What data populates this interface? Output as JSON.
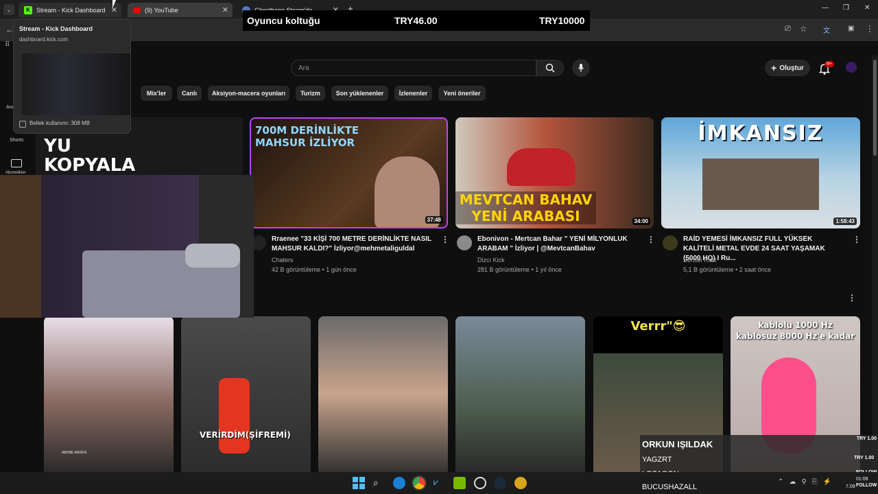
{
  "browser": {
    "tabs": [
      {
        "title": "Stream - Kick Dashboard",
        "icon": "kick-icon",
        "color": "#53fc18"
      },
      {
        "title": "(9) YouTube",
        "icon": "youtube-icon",
        "color": "#ff0000"
      },
      {
        "title": "Ghostbane Steam'de",
        "icon": "steam-icon",
        "color": "#4f7bc4"
      }
    ],
    "new_tab_label": "+"
  },
  "tab_preview": {
    "title": "Stream - Kick Dashboard",
    "url": "dashboard.kick.com",
    "memory": "Bellek kullanımı: 308 MB"
  },
  "price_overlay": {
    "item": "Oyuncu koltuğu",
    "current": "TRY46.00",
    "goal": "TRY10000"
  },
  "youtube": {
    "search_placeholder": "Ara",
    "create_label": "Oluştur",
    "notifications": "9+",
    "sidebar": [
      {
        "label": "Ana",
        "icon": "home-icon"
      },
      {
        "label": "Shorts",
        "icon": "shorts-icon"
      },
      {
        "label": "Abonelikler",
        "icon": "subscriptions-icon"
      }
    ],
    "chips": [
      "Mix'ler",
      "Canlı",
      "Aksiyon-macera oyunları",
      "Turizm",
      "Son yüklenenler",
      "İzlenenler",
      "Yeni öneriler"
    ],
    "videos": [
      {
        "thumb_text": "700M DERİNLİKTE MAHSUR İZLİYOR",
        "duration": "37:48",
        "title": "Rraenee \"33 KİŞİ 700 METRE DERİNLİKTE NASIL MAHSUR KALDI?\" İzliyor@mehmetaliguldal",
        "channel": "Chaters",
        "meta": "42 B görüntüleme • 1 gün önce"
      },
      {
        "thumb_text": "MEVTCAN BAHAV YENİ ARABASI",
        "duration": "34:00",
        "title": "Ebonivon - Mertcan Bahar \" YENİ MİLYONLUK ARABAM \" İzliyor | @MevtcanBahav",
        "channel": "Dizcı Kick",
        "meta": "281 B görüntüleme • 1 yıl önce"
      },
      {
        "thumb_text": "İMKANSIZ",
        "duration": "1:58:43",
        "title": "RAİD YEMESİ İMKANSIZ FULL YÜKSEK KALİTELİ METAL EVDE 24 SAAT YAŞAMAK (5000 HQ) I Ru...",
        "channel": "Sensei Rust",
        "meta": "5,1 B görüntüleme • 2 saat önce"
      }
    ],
    "partial_thumb_text": "YU KOPYALA",
    "shorts": [
      {
        "thumb_text": "",
        "bottom_text": "ABONE ARDEN"
      },
      {
        "thumb_text": "VERİRDİM(ŞİFREMİ)",
        "bottom_text": ""
      },
      {
        "thumb_text": "",
        "bottom_text": ""
      },
      {
        "thumb_text": "",
        "bottom_text": ""
      },
      {
        "thumb_text": "Verrr\"😎",
        "bottom_text": ""
      },
      {
        "thumb_text": "kablolu 1000 Hz\nkablosuz 8000 Hz'e kadar",
        "bottom_text": ""
      }
    ]
  },
  "leaderboard": {
    "rows": [
      {
        "name": "ORKUN IŞILDAK",
        "amount": "TRY 1.00"
      },
      {
        "name": "YAGZRT",
        "amount": "TRY 1.00"
      },
      {
        "name": "LOZAGON",
        "amount": "FOLLOW"
      },
      {
        "name": "BUCUSHAZALL",
        "amount": "FOLLOW"
      }
    ]
  },
  "taskbar": {
    "clock": "01:08",
    "date": "7.09"
  }
}
